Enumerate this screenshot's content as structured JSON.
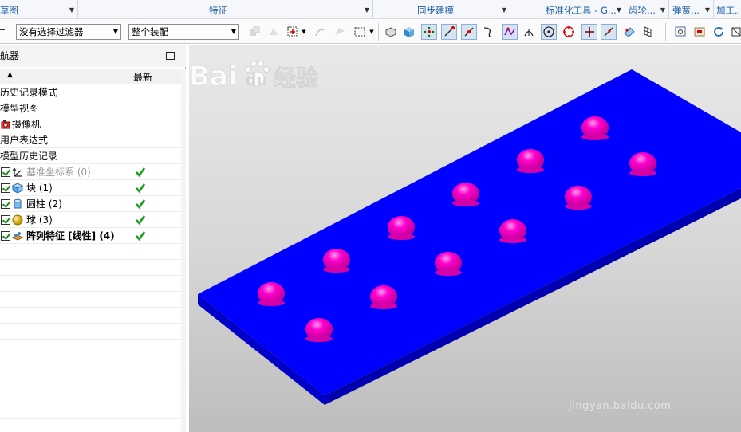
{
  "ribbon_groups": [
    "草图",
    "特征",
    "同步建模",
    "标准化工具 - G...",
    "齿轮...",
    "弹簧...",
    "加工..."
  ],
  "toolbar": {
    "filter_value": "没有选择过滤器",
    "assembly_value": "整个装配"
  },
  "navigator": {
    "title": "航器",
    "column_latest": "最新",
    "rows": [
      {
        "label": "历史记录模式",
        "style": "normal"
      },
      {
        "label": "模型视图",
        "style": "normal"
      },
      {
        "label": "摄像机",
        "style": "normal",
        "icon": "camera-icon"
      },
      {
        "label": "用户表达式",
        "style": "normal"
      },
      {
        "label": "模型历史记录",
        "style": "normal"
      },
      {
        "label": "基准坐标系 (0)",
        "style": "gray",
        "icon": "datum-csys-icon",
        "checked": true,
        "latest": true
      },
      {
        "label": "块 (1)",
        "style": "normal",
        "icon": "block-icon",
        "checked": true,
        "latest": true
      },
      {
        "label": "圆柱 (2)",
        "style": "normal",
        "icon": "cylinder-icon",
        "checked": true,
        "latest": true
      },
      {
        "label": "球 (3)",
        "style": "normal",
        "icon": "sphere-icon",
        "checked": true,
        "latest": true
      },
      {
        "label": "阵列特征 [线性] (4)",
        "style": "bold",
        "icon": "pattern-feature-icon",
        "checked": true,
        "latest": true
      }
    ]
  },
  "viewport": {
    "plate_color": "#0000ff",
    "bump_color": "#ff00cc",
    "background_top": "#e9e9e9",
    "background_bottom": "#bdbdbd"
  },
  "watermark": {
    "brand": "Bai",
    "brand2": "du",
    "cn": "经验",
    "url": "jingyan.baidu.com"
  }
}
